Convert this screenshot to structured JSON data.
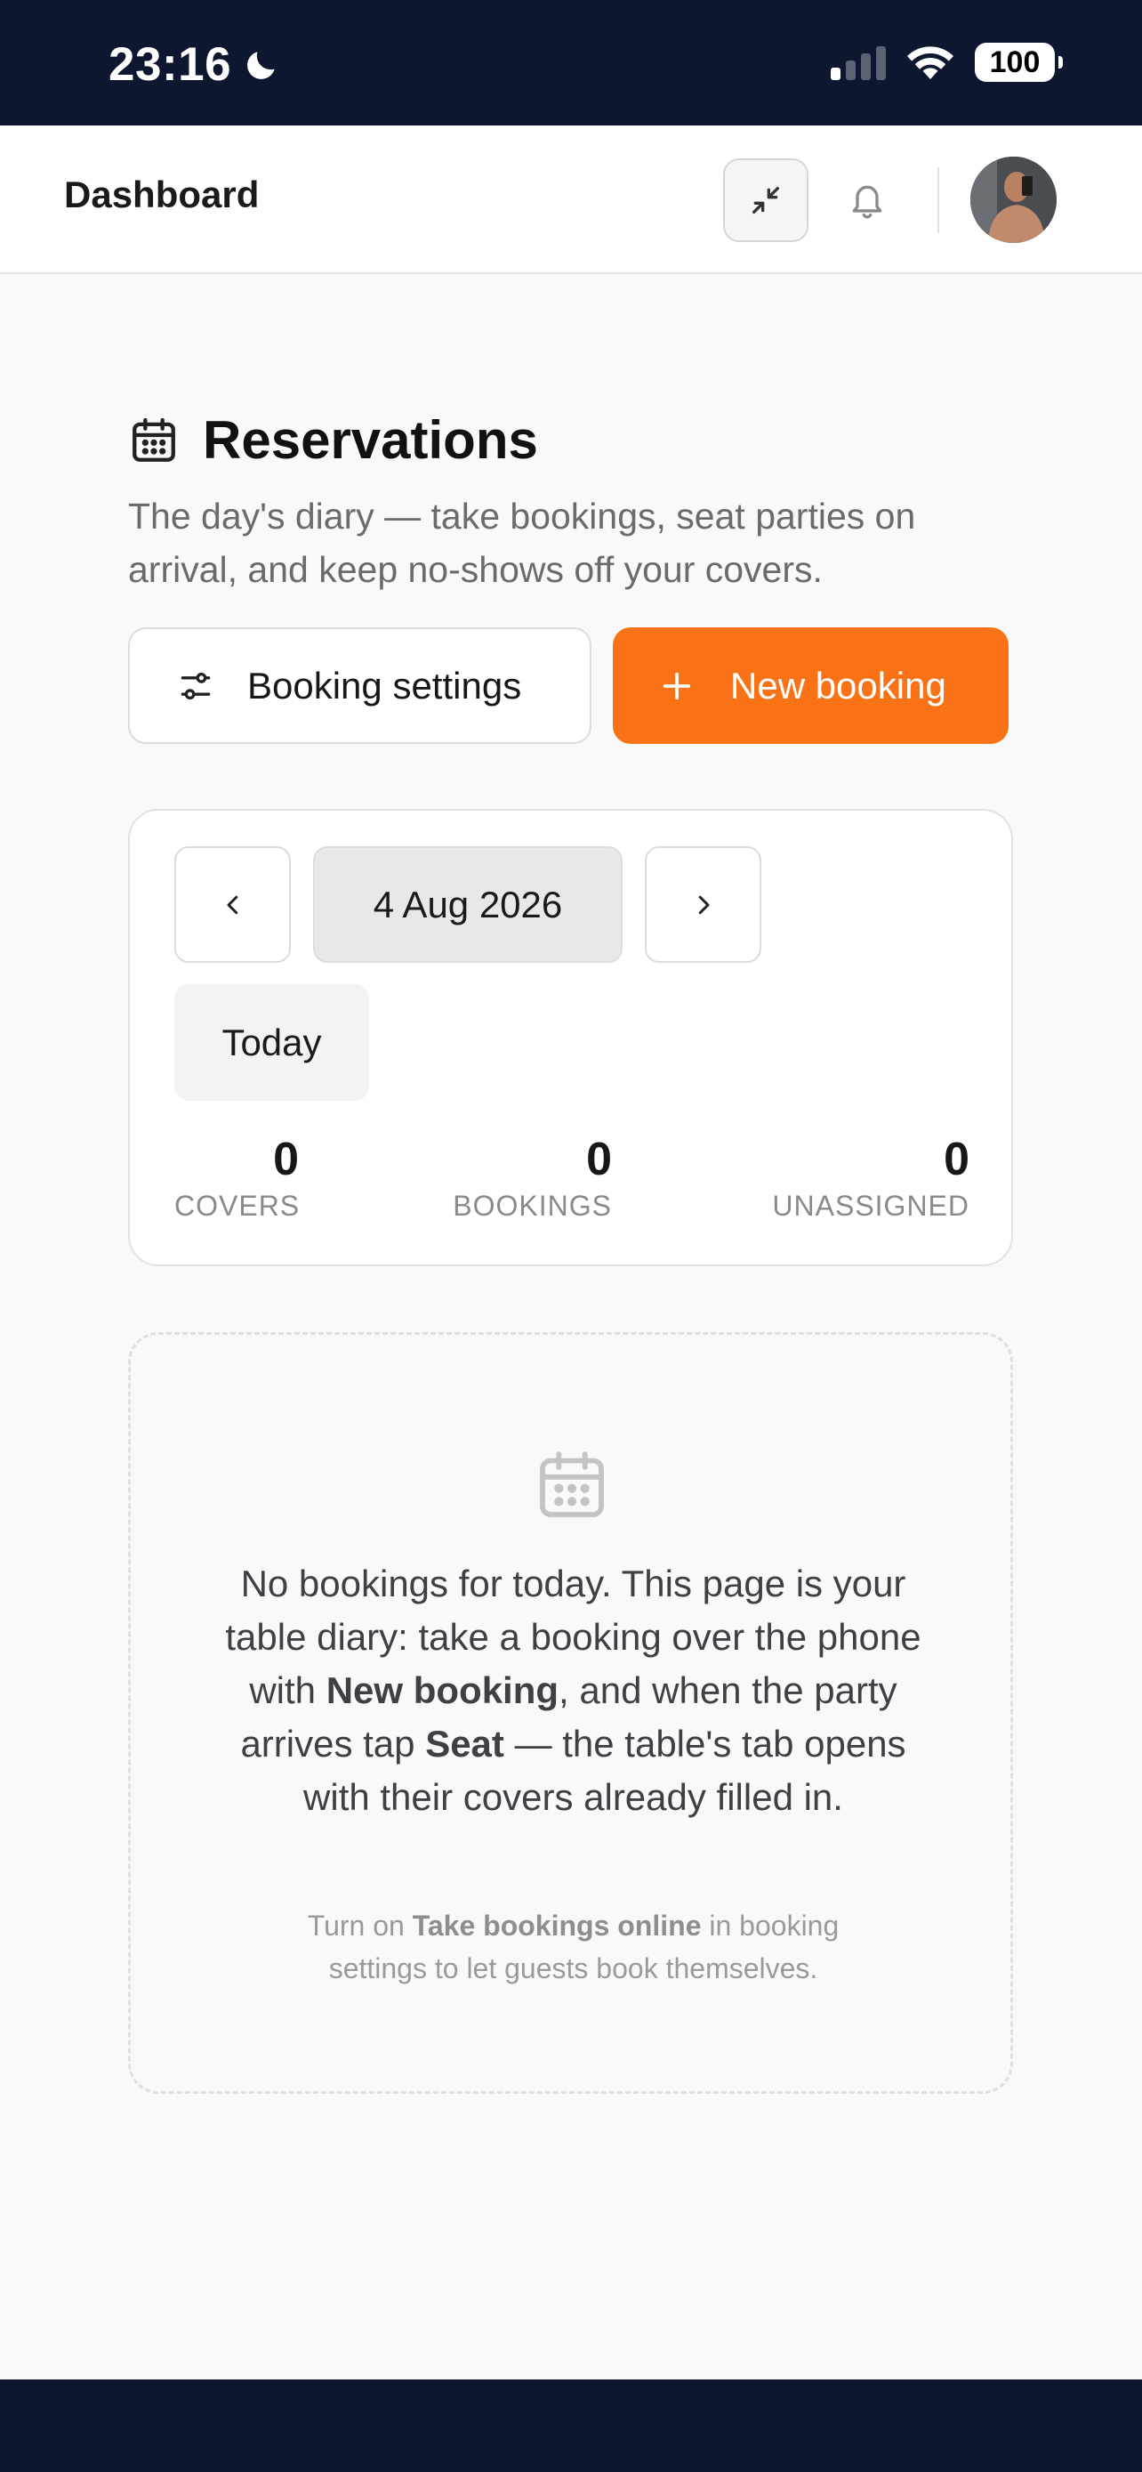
{
  "status_bar": {
    "time": "23:16",
    "battery": "100",
    "icons": [
      "moon-icon",
      "signal-icon",
      "wifi-icon",
      "battery-icon"
    ]
  },
  "header": {
    "title": "Dashboard",
    "icons": [
      "collapse-icon",
      "bell-icon",
      "avatar"
    ]
  },
  "reservations": {
    "title": "Reservations",
    "subtitle": "The day's diary — take bookings, seat parties on arrival, and keep no-shows off your covers.",
    "settings_button": "Booking settings",
    "new_button": "New booking"
  },
  "date_nav": {
    "date": "4 Aug 2026",
    "today_label": "Today",
    "stats": [
      {
        "value": "0",
        "label": "COVERS"
      },
      {
        "value": "0",
        "label": "BOOKINGS"
      },
      {
        "value": "0",
        "label": "UNASSIGNED"
      }
    ]
  },
  "empty_state": {
    "message_parts": [
      "No bookings for today. This page is your table diary: take a booking over the phone with ",
      "New booking",
      ", and when the party arrives tap ",
      "Seat",
      " — the table's tab opens with their covers already filled in."
    ],
    "hint_parts": [
      "Turn on ",
      "Take bookings online",
      " in booking settings to let guests book themselves."
    ]
  },
  "colors": {
    "accent": "#f97316",
    "status_bar_bg": "#0d1730",
    "page_bg": "#f9f9f9"
  }
}
